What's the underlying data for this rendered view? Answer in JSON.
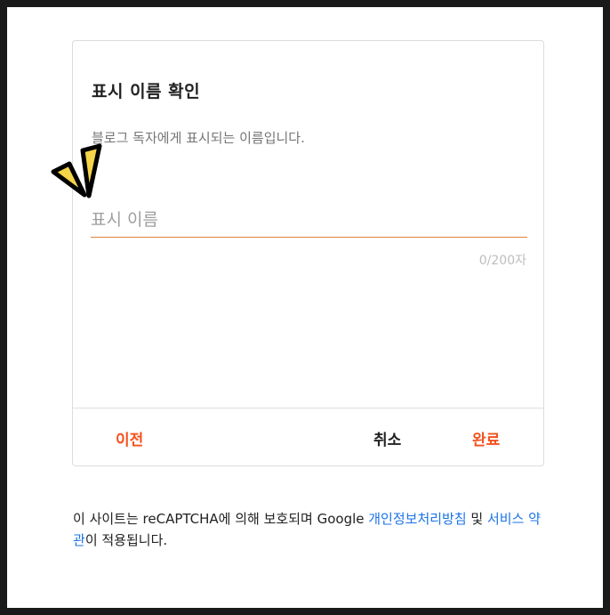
{
  "dialog": {
    "title": "표시 이름 확인",
    "description": "블로그 독자에게 표시되는 이름입니다.",
    "input": {
      "placeholder": "표시 이름",
      "value": ""
    },
    "char_counter": "0/200자",
    "buttons": {
      "prev": "이전",
      "cancel": "취소",
      "done": "완료"
    }
  },
  "notice": {
    "prefix": "이 사이트는 reCAPTCHA에 의해 보호되며 Google ",
    "privacy_link": "개인정보처리방침",
    "middle": " 및 ",
    "terms_link": "서비스 약관",
    "suffix": "이 적용됩니다."
  },
  "colors": {
    "accent": "#f4511e",
    "input_underline": "#e0833b",
    "link": "#1a73e8",
    "sparkle_fill": "#f4d54a"
  },
  "icons": {
    "annotation": "attention-sparkle-icon"
  }
}
